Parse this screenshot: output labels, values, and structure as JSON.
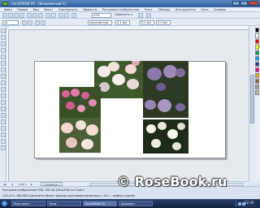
{
  "window": {
    "title": "CorelDRAW X5 - [Безымянный-1]"
  },
  "menu": [
    "Файл",
    "Правка",
    "Вид",
    "Макет",
    "Упорядочить",
    "Эффекты",
    "Растровые изображения",
    "Текст",
    "Таблица",
    "Инструменты",
    "Окно",
    "Справка"
  ],
  "toolbar": {
    "zoom": "43%",
    "snap_label": "Привязать к",
    "paper": "A4",
    "unit": "миллиметры",
    "nudge": "0,1 мм",
    "dup_x": "5,0 мм",
    "dup_y": "5,0 мм"
  },
  "pages": {
    "nav": "1 из 1",
    "tab": "Страница 1"
  },
  "status": {
    "line1": "Растровое изображение RGB, 300 dpi (600x450) на Слой 1",
    "line2": "(159,474; 189,962)   Щелкните объект дважды для поворота/наклона; с Ctrl — выбор в группе"
  },
  "watermark": "© RoseBook.ru",
  "taskbar": {
    "tasks": [
      "Роза сорта",
      "Розы",
      "CorelDRAW X5",
      "Документ"
    ],
    "clock": "12:43"
  },
  "colors": {
    "palette": [
      "#000000",
      "#ffffff",
      "#ff0000",
      "#ffff00",
      "#00a651",
      "#00aeef",
      "#2e3192",
      "#ec008c",
      "#f7941d",
      "#8b5e3c",
      "#999999",
      "#c2b59b"
    ]
  }
}
